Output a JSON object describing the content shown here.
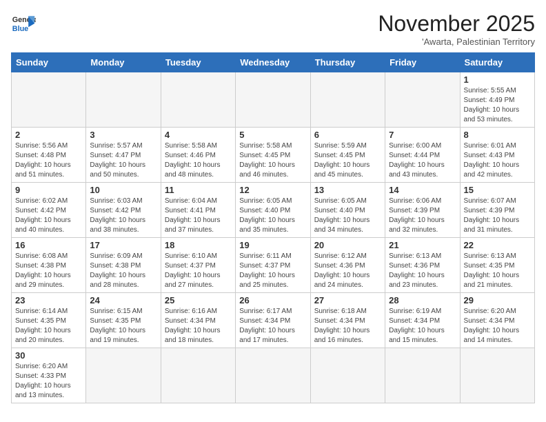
{
  "header": {
    "logo_general": "General",
    "logo_blue": "Blue",
    "month": "November 2025",
    "location": "'Awarta, Palestinian Territory"
  },
  "weekdays": [
    "Sunday",
    "Monday",
    "Tuesday",
    "Wednesday",
    "Thursday",
    "Friday",
    "Saturday"
  ],
  "days": [
    {
      "num": "",
      "info": ""
    },
    {
      "num": "",
      "info": ""
    },
    {
      "num": "",
      "info": ""
    },
    {
      "num": "",
      "info": ""
    },
    {
      "num": "",
      "info": ""
    },
    {
      "num": "",
      "info": ""
    },
    {
      "num": "1",
      "info": "Sunrise: 5:55 AM\nSunset: 4:49 PM\nDaylight: 10 hours and 53 minutes."
    },
    {
      "num": "2",
      "info": "Sunrise: 5:56 AM\nSunset: 4:48 PM\nDaylight: 10 hours and 51 minutes."
    },
    {
      "num": "3",
      "info": "Sunrise: 5:57 AM\nSunset: 4:47 PM\nDaylight: 10 hours and 50 minutes."
    },
    {
      "num": "4",
      "info": "Sunrise: 5:58 AM\nSunset: 4:46 PM\nDaylight: 10 hours and 48 minutes."
    },
    {
      "num": "5",
      "info": "Sunrise: 5:58 AM\nSunset: 4:45 PM\nDaylight: 10 hours and 46 minutes."
    },
    {
      "num": "6",
      "info": "Sunrise: 5:59 AM\nSunset: 4:45 PM\nDaylight: 10 hours and 45 minutes."
    },
    {
      "num": "7",
      "info": "Sunrise: 6:00 AM\nSunset: 4:44 PM\nDaylight: 10 hours and 43 minutes."
    },
    {
      "num": "8",
      "info": "Sunrise: 6:01 AM\nSunset: 4:43 PM\nDaylight: 10 hours and 42 minutes."
    },
    {
      "num": "9",
      "info": "Sunrise: 6:02 AM\nSunset: 4:42 PM\nDaylight: 10 hours and 40 minutes."
    },
    {
      "num": "10",
      "info": "Sunrise: 6:03 AM\nSunset: 4:42 PM\nDaylight: 10 hours and 38 minutes."
    },
    {
      "num": "11",
      "info": "Sunrise: 6:04 AM\nSunset: 4:41 PM\nDaylight: 10 hours and 37 minutes."
    },
    {
      "num": "12",
      "info": "Sunrise: 6:05 AM\nSunset: 4:40 PM\nDaylight: 10 hours and 35 minutes."
    },
    {
      "num": "13",
      "info": "Sunrise: 6:05 AM\nSunset: 4:40 PM\nDaylight: 10 hours and 34 minutes."
    },
    {
      "num": "14",
      "info": "Sunrise: 6:06 AM\nSunset: 4:39 PM\nDaylight: 10 hours and 32 minutes."
    },
    {
      "num": "15",
      "info": "Sunrise: 6:07 AM\nSunset: 4:39 PM\nDaylight: 10 hours and 31 minutes."
    },
    {
      "num": "16",
      "info": "Sunrise: 6:08 AM\nSunset: 4:38 PM\nDaylight: 10 hours and 29 minutes."
    },
    {
      "num": "17",
      "info": "Sunrise: 6:09 AM\nSunset: 4:38 PM\nDaylight: 10 hours and 28 minutes."
    },
    {
      "num": "18",
      "info": "Sunrise: 6:10 AM\nSunset: 4:37 PM\nDaylight: 10 hours and 27 minutes."
    },
    {
      "num": "19",
      "info": "Sunrise: 6:11 AM\nSunset: 4:37 PM\nDaylight: 10 hours and 25 minutes."
    },
    {
      "num": "20",
      "info": "Sunrise: 6:12 AM\nSunset: 4:36 PM\nDaylight: 10 hours and 24 minutes."
    },
    {
      "num": "21",
      "info": "Sunrise: 6:13 AM\nSunset: 4:36 PM\nDaylight: 10 hours and 23 minutes."
    },
    {
      "num": "22",
      "info": "Sunrise: 6:13 AM\nSunset: 4:35 PM\nDaylight: 10 hours and 21 minutes."
    },
    {
      "num": "23",
      "info": "Sunrise: 6:14 AM\nSunset: 4:35 PM\nDaylight: 10 hours and 20 minutes."
    },
    {
      "num": "24",
      "info": "Sunrise: 6:15 AM\nSunset: 4:35 PM\nDaylight: 10 hours and 19 minutes."
    },
    {
      "num": "25",
      "info": "Sunrise: 6:16 AM\nSunset: 4:34 PM\nDaylight: 10 hours and 18 minutes."
    },
    {
      "num": "26",
      "info": "Sunrise: 6:17 AM\nSunset: 4:34 PM\nDaylight: 10 hours and 17 minutes."
    },
    {
      "num": "27",
      "info": "Sunrise: 6:18 AM\nSunset: 4:34 PM\nDaylight: 10 hours and 16 minutes."
    },
    {
      "num": "28",
      "info": "Sunrise: 6:19 AM\nSunset: 4:34 PM\nDaylight: 10 hours and 15 minutes."
    },
    {
      "num": "29",
      "info": "Sunrise: 6:20 AM\nSunset: 4:34 PM\nDaylight: 10 hours and 14 minutes."
    },
    {
      "num": "30",
      "info": "Sunrise: 6:20 AM\nSunset: 4:33 PM\nDaylight: 10 hours and 13 minutes."
    },
    {
      "num": "",
      "info": ""
    },
    {
      "num": "",
      "info": ""
    },
    {
      "num": "",
      "info": ""
    },
    {
      "num": "",
      "info": ""
    },
    {
      "num": "",
      "info": ""
    },
    {
      "num": "",
      "info": ""
    }
  ]
}
